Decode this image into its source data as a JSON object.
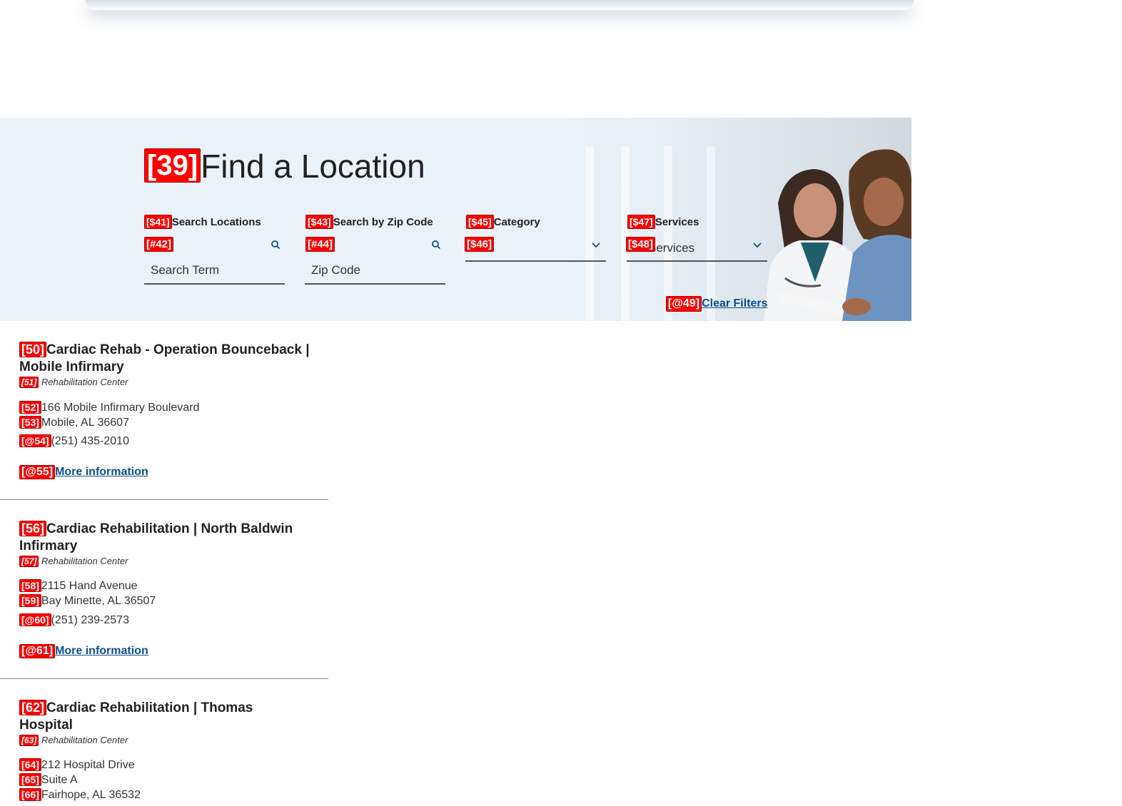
{
  "hero": {
    "title_tag": "[39]",
    "title": "Find a Location"
  },
  "filters": {
    "search_locations": {
      "label_tag": "[$41]",
      "label": "Search Locations",
      "field_tag": "[#42]",
      "placeholder": "Search Term",
      "icon": "search-icon"
    },
    "zip_code": {
      "label_tag": "[$43]",
      "label": "Search by Zip Code",
      "field_tag": "[#44]",
      "placeholder": "Zip Code",
      "icon": "search-icon"
    },
    "category": {
      "label_tag": "[$45]",
      "label": "Category",
      "field_tag": "[$46]",
      "value": "",
      "icon": "chevron-down-icon"
    },
    "services": {
      "label_tag": "[$47]",
      "label": "Services",
      "field_tag": "[$48]",
      "value": "Services",
      "icon": "chevron-down-icon"
    },
    "clear": {
      "tag": "[@49]",
      "label": "Clear Filters"
    }
  },
  "results": [
    {
      "title_tag": "[50]",
      "title": "Cardiac Rehab - Operation Bounceback | Mobile Infirmary",
      "category_tag": "[51]",
      "category": "Rehabilitation Center",
      "address_lines": [
        {
          "tag": "[52]",
          "text": "166 Mobile Infirmary Boulevard"
        },
        {
          "tag": "[53]",
          "text": "Mobile, AL 36607"
        }
      ],
      "phone_tag": "[@54]",
      "phone": "(251) 435-2010",
      "more_tag": "[@55]",
      "more": "More information"
    },
    {
      "title_tag": "[56]",
      "title": "Cardiac Rehabilitation | North Baldwin Infirmary",
      "category_tag": "[57]",
      "category": "Rehabilitation Center",
      "address_lines": [
        {
          "tag": "[58]",
          "text": "2115 Hand Avenue"
        },
        {
          "tag": "[59]",
          "text": "Bay Minette, AL 36507"
        }
      ],
      "phone_tag": "[@60]",
      "phone": "(251) 239-2573",
      "more_tag": "[@61]",
      "more": "More information"
    },
    {
      "title_tag": "[62]",
      "title": "Cardiac Rehabilitation | Thomas Hospital",
      "category_tag": "[63]",
      "category": "Rehabilitation Center",
      "address_lines": [
        {
          "tag": "[64]",
          "text": "212 Hospital Drive"
        },
        {
          "tag": "[65]",
          "text": "Suite A"
        },
        {
          "tag": "[66]",
          "text": "Fairhope, AL 36532"
        }
      ]
    }
  ],
  "colors": {
    "hero_bg": "#eaf2fa",
    "link": "#0d4f8c",
    "tag": "#ff0000"
  }
}
